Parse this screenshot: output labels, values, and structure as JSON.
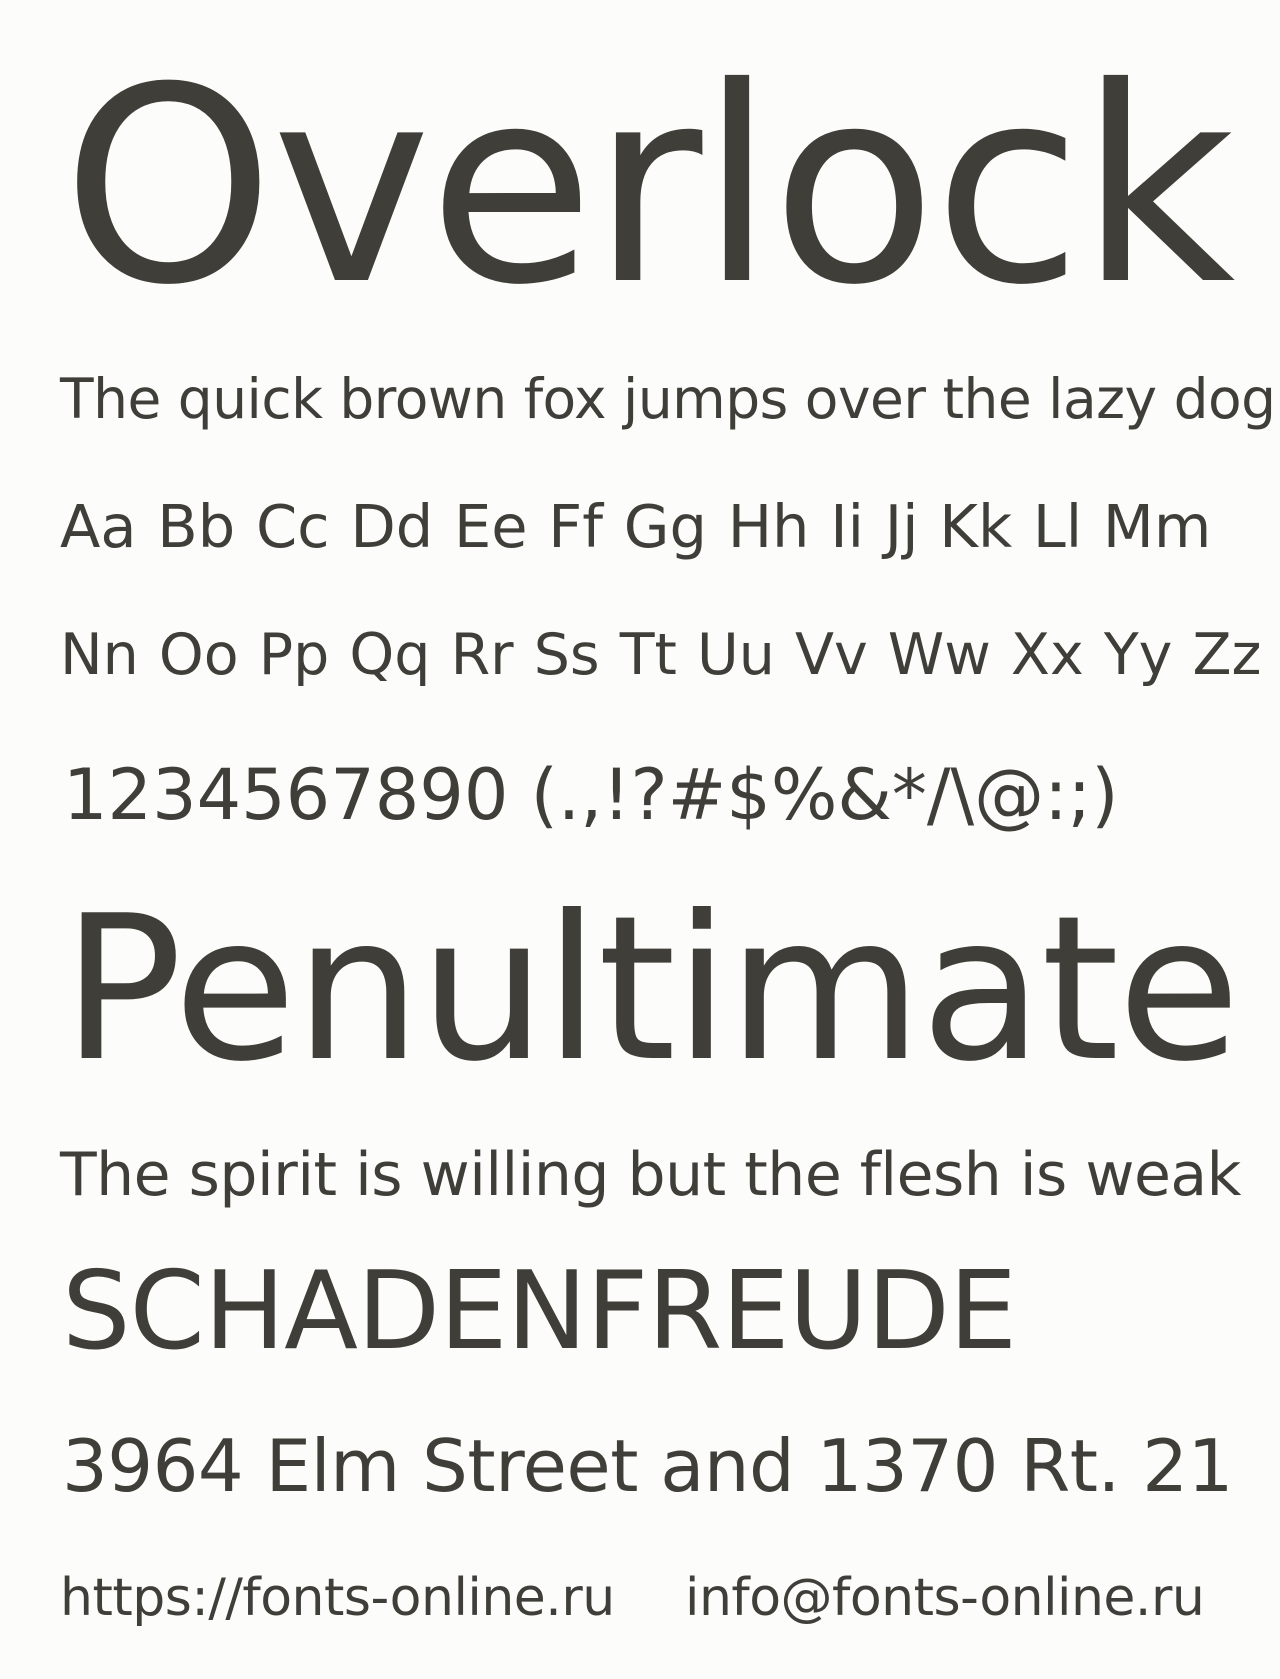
{
  "sheet": {
    "title": "Overlock",
    "pangram": "The quick brown fox jumps over the lazy dog",
    "alphabet_line_1": "Aa Bb Cc Dd Ee Ff Gg Hh Ii Jj Kk Ll Mm",
    "alphabet_line_2": "Nn Oo Pp Qq Rr Ss Tt Uu Vv Ww Xx Yy Zz",
    "digits_and_symbols": "1234567890 (.,!?#$%&*/\\@:;)",
    "sample_word": "Penultimate",
    "sample_phrase": "The spirit is willing but the flesh is weak",
    "sample_caps": "SCHADENFREUDE",
    "sample_address": "3964 Elm Street and 1370 Rt. 21"
  },
  "footer": {
    "website": "https://fonts-online.ru",
    "email": "info@fonts-online.ru"
  },
  "colors": {
    "background": "#fcfcfa",
    "text": "#403e39"
  }
}
